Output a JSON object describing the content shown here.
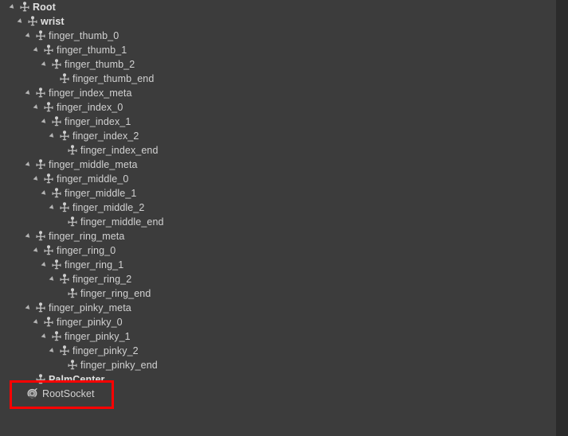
{
  "panel": {
    "name": "hierarchy-tree-panel",
    "background_color": "#3c3c3c",
    "text_color": "#d2d2d2",
    "scrollbar_color": "#2b2b2b"
  },
  "annotation": {
    "color": "#fe0000",
    "target_label": "RootSocket"
  },
  "tree": {
    "rows": [
      {
        "label": "Root",
        "depth": 0,
        "expanded": true,
        "icon": "bone-icon",
        "bold": true
      },
      {
        "label": "wrist",
        "depth": 1,
        "expanded": true,
        "icon": "bone-icon",
        "bold": true
      },
      {
        "label": "finger_thumb_0",
        "depth": 2,
        "expanded": true,
        "icon": "bone-icon",
        "bold": false
      },
      {
        "label": "finger_thumb_1",
        "depth": 3,
        "expanded": true,
        "icon": "bone-icon",
        "bold": false
      },
      {
        "label": "finger_thumb_2",
        "depth": 4,
        "expanded": true,
        "icon": "bone-icon",
        "bold": false
      },
      {
        "label": "finger_thumb_end",
        "depth": 5,
        "expanded": false,
        "icon": "bone-icon",
        "bold": false
      },
      {
        "label": "finger_index_meta",
        "depth": 2,
        "expanded": true,
        "icon": "bone-icon",
        "bold": false
      },
      {
        "label": "finger_index_0",
        "depth": 3,
        "expanded": true,
        "icon": "bone-icon",
        "bold": false
      },
      {
        "label": "finger_index_1",
        "depth": 4,
        "expanded": true,
        "icon": "bone-icon",
        "bold": false
      },
      {
        "label": "finger_index_2",
        "depth": 5,
        "expanded": true,
        "icon": "bone-icon",
        "bold": false
      },
      {
        "label": "finger_index_end",
        "depth": 6,
        "expanded": false,
        "icon": "bone-icon",
        "bold": false
      },
      {
        "label": "finger_middle_meta",
        "depth": 2,
        "expanded": true,
        "icon": "bone-icon",
        "bold": false
      },
      {
        "label": "finger_middle_0",
        "depth": 3,
        "expanded": true,
        "icon": "bone-icon",
        "bold": false
      },
      {
        "label": "finger_middle_1",
        "depth": 4,
        "expanded": true,
        "icon": "bone-icon",
        "bold": false
      },
      {
        "label": "finger_middle_2",
        "depth": 5,
        "expanded": true,
        "icon": "bone-icon",
        "bold": false
      },
      {
        "label": "finger_middle_end",
        "depth": 6,
        "expanded": false,
        "icon": "bone-icon",
        "bold": false
      },
      {
        "label": "finger_ring_meta",
        "depth": 2,
        "expanded": true,
        "icon": "bone-icon",
        "bold": false
      },
      {
        "label": "finger_ring_0",
        "depth": 3,
        "expanded": true,
        "icon": "bone-icon",
        "bold": false
      },
      {
        "label": "finger_ring_1",
        "depth": 4,
        "expanded": true,
        "icon": "bone-icon",
        "bold": false
      },
      {
        "label": "finger_ring_2",
        "depth": 5,
        "expanded": true,
        "icon": "bone-icon",
        "bold": false
      },
      {
        "label": "finger_ring_end",
        "depth": 6,
        "expanded": false,
        "icon": "bone-icon",
        "bold": false
      },
      {
        "label": "finger_pinky_meta",
        "depth": 2,
        "expanded": true,
        "icon": "bone-icon",
        "bold": false
      },
      {
        "label": "finger_pinky_0",
        "depth": 3,
        "expanded": true,
        "icon": "bone-icon",
        "bold": false
      },
      {
        "label": "finger_pinky_1",
        "depth": 4,
        "expanded": true,
        "icon": "bone-icon",
        "bold": false
      },
      {
        "label": "finger_pinky_2",
        "depth": 5,
        "expanded": true,
        "icon": "bone-icon",
        "bold": false
      },
      {
        "label": "finger_pinky_end",
        "depth": 6,
        "expanded": false,
        "icon": "bone-icon",
        "bold": false
      },
      {
        "label": "PalmCenter",
        "depth": 2,
        "expanded": false,
        "icon": "bone-icon",
        "bold": true
      },
      {
        "label": "RootSocket",
        "depth": 1,
        "expanded": false,
        "icon": "socket-icon",
        "bold": false
      }
    ]
  }
}
